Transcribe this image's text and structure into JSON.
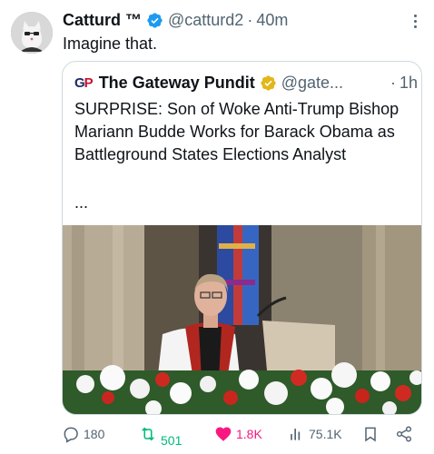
{
  "tweet": {
    "display_name": "Catturd ™",
    "handle": "@catturd2",
    "separator": "·",
    "time": "40m",
    "text": "Imagine that.",
    "avatar_icon": "cat-avatar",
    "verified_icon": "verified-blue-badge",
    "verified_color": "#1d9bf0",
    "more_icon": "more-vertical-icon"
  },
  "quote": {
    "logo_text_g": "G",
    "logo_text_p": "P",
    "display_name": "The Gateway Pundit",
    "handle": "@gate...",
    "separator": "·",
    "time": "1h",
    "verified_icon": "verified-gold-badge",
    "verified_color": "#e2b719",
    "text": "SURPRISE: Son of Woke Anti-Trump Bishop Mariann Budde Works for Barack Obama as Battleground States Elections Analyst",
    "ellipsis": "...",
    "photo_icon": "bishop-at-pulpit-photo"
  },
  "actions": {
    "reply": {
      "icon": "reply-icon",
      "count": "180"
    },
    "retweet": {
      "icon": "retweet-icon",
      "count": "501",
      "color": "#00ba7c"
    },
    "like": {
      "icon": "heart-filled-icon",
      "count": "1.8K",
      "color": "#f91880"
    },
    "views": {
      "icon": "views-icon",
      "count": "75.1K"
    },
    "bookmark": {
      "icon": "bookmark-icon"
    },
    "share": {
      "icon": "share-icon"
    }
  }
}
